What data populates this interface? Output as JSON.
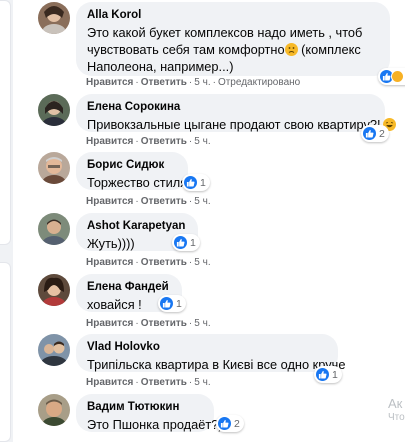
{
  "comments": [
    {
      "author": "Alla Korol",
      "text_lines": [
        "Это какой букет комплексов надо иметь , чтоб",
        "чувствовать себя там комфортно",
        " (комплекс",
        "Наполеона, например...)"
      ],
      "like_label": "Нравится",
      "reply_label": "Ответить",
      "time": "5 ч.",
      "edited": "Отредактировано",
      "reaction_count": "2",
      "reactions": [
        "like-icon",
        "haha-icon"
      ],
      "emoji": "sad-emoji"
    },
    {
      "author": "Елена Сорокина",
      "text": "Привокзальные цыгане продают свою квартиру?!",
      "emoji": "laugh-emoji",
      "like_label": "Нравится",
      "reply_label": "Ответить",
      "time": "5 ч.",
      "reaction_count": "2",
      "reactions": [
        "like-icon"
      ]
    },
    {
      "author": "Борис Сидюк",
      "text": "Торжество стиля",
      "like_label": "Нравится",
      "reply_label": "Ответить",
      "time": "5 ч.",
      "reaction_count": "1",
      "reactions": [
        "like-icon"
      ]
    },
    {
      "author": "Ashot Karapetyan",
      "text": "Жуть))))",
      "like_label": "Нравится",
      "reply_label": "Ответить",
      "time": "5 ч.",
      "reaction_count": "1",
      "reactions": [
        "like-icon"
      ]
    },
    {
      "author": "Елена Фандей",
      "text": "ховайся !",
      "like_label": "Нравится",
      "reply_label": "Ответить",
      "time": "5 ч.",
      "reaction_count": "1",
      "reactions": [
        "like-icon"
      ]
    },
    {
      "author": "Vlad Holovko",
      "text": "Трипільска квартира в Києві все одно круче",
      "like_label": "Нравится",
      "reply_label": "Ответить",
      "time": "5 ч.",
      "reaction_count": "1",
      "reactions": [
        "like-icon"
      ]
    },
    {
      "author": "Вадим Тютюкин",
      "text": "Это Пшонка продаёт?)",
      "reaction_count": "2",
      "reactions": [
        "like-icon"
      ]
    }
  ],
  "watermark": {
    "line1": "Ак",
    "line2": "Что"
  },
  "colors": {
    "like_blue": "#1877f2",
    "bubble_bg": "#f0f2f5",
    "meta_gray": "#65676b"
  }
}
